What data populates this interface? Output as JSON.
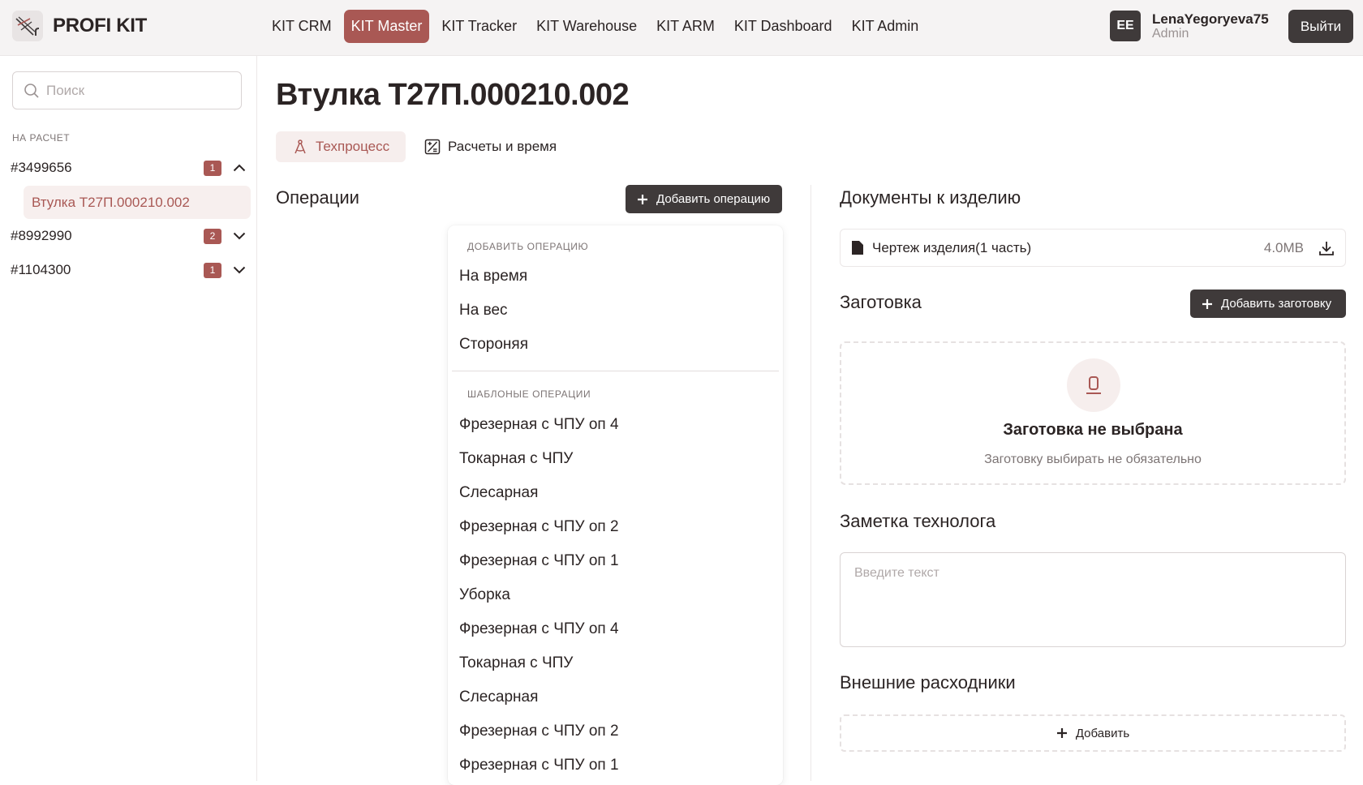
{
  "app": {
    "brand": "PROFI KIT",
    "nav": [
      {
        "label": "KIT CRM",
        "active": false
      },
      {
        "label": "KIT Master",
        "active": true
      },
      {
        "label": "KIT Tracker",
        "active": false
      },
      {
        "label": "KIT Warehouse",
        "active": false
      },
      {
        "label": "KIT ARM",
        "active": false
      },
      {
        "label": "KIT Dashboard",
        "active": false
      },
      {
        "label": "KIT Admin",
        "active": false
      }
    ],
    "user": {
      "initials": "EE",
      "name": "LenaYegoryeva75",
      "role": "Admin"
    },
    "logout_label": "Выйти",
    "accent": "#a95854",
    "dark": "#3f3a3a"
  },
  "sidebar": {
    "search_placeholder": "Поиск",
    "section_label": "НА РАСЧЕТ",
    "orders": [
      {
        "number": "#3499656",
        "count": "1",
        "expanded": true,
        "items": [
          "Втулка Т27П.000210.002"
        ]
      },
      {
        "number": "#8992990",
        "count": "2",
        "expanded": false
      },
      {
        "number": "#1104300",
        "count": "1",
        "expanded": false
      }
    ]
  },
  "main": {
    "title": "Втулка Т27П.000210.002",
    "tabs": [
      {
        "label": "Техпроцесс",
        "icon": "compass-icon",
        "active": true
      },
      {
        "label": "Расчеты и время",
        "icon": "calculator-icon",
        "active": false
      }
    ],
    "operations": {
      "heading": "Операции",
      "add_button": "Добавить операцию",
      "dropdown": {
        "section1_label": "ДОБАВИТЬ ОПЕРАЦИЮ",
        "basic": [
          "На время",
          "На вес",
          "Стороняя"
        ],
        "section2_label": "ШАБЛОНЫЕ ОПЕРАЦИИ",
        "templates": [
          "Фрезерная с ЧПУ оп 4",
          "Токарная с ЧПУ",
          "Слесарная",
          "Фрезерная с ЧПУ оп 2",
          "Фрезерная с ЧПУ оп 1",
          "Уборка",
          "Фрезерная с ЧПУ оп 4",
          "Токарная с ЧПУ",
          "Слесарная",
          "Фрезерная с ЧПУ оп 2",
          "Фрезерная с ЧПУ оп 1"
        ]
      }
    },
    "documents": {
      "heading": "Документы к изделию",
      "files": [
        {
          "name": "Чертеж изделия(1 часть)",
          "size": "4.0MB"
        }
      ]
    },
    "blank": {
      "heading": "Заготовка",
      "add_button": "Добавить заготовку",
      "empty_title": "Заготовка не выбрана",
      "empty_subtitle": "Заготовку выбирать не обязательно"
    },
    "note": {
      "heading": "Заметка технолога",
      "placeholder": "Введите текст"
    },
    "consumables": {
      "heading": "Внешние расходники",
      "add_label": "Добавить"
    }
  }
}
